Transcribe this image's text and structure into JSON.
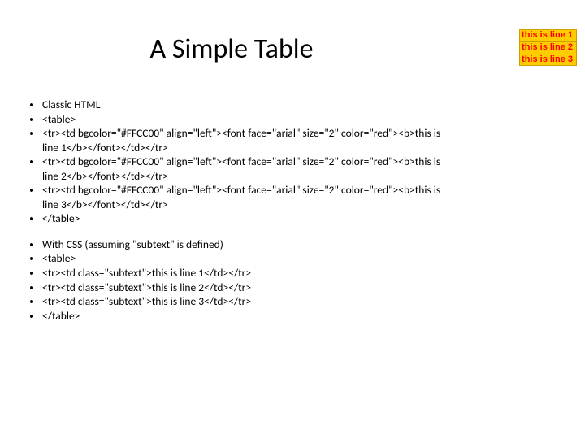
{
  "title": "A Simple Table",
  "block1": {
    "l1": "Classic HTML",
    "l2": "<table>",
    "l3": "<tr><td bgcolor=\"#FFCC00\" align=\"left\"><font face=\"arial\" size=\"2\" color=\"red\"><b>this is line 1</b></font></td></tr>",
    "l4": "<tr><td bgcolor=\"#FFCC00\" align=\"left\"><font face=\"arial\" size=\"2\" color=\"red\"><b>this is line 2</b></font></td></tr>",
    "l5": "<tr><td bgcolor=\"#FFCC00\" align=\"left\"><font face=\"arial\" size=\"2\" color=\"red\"><b>this is line 3</b></font></td></tr>",
    "l6": "</table>"
  },
  "block2": {
    "l1": "With CSS (assuming \"subtext\" is defined)",
    "l2": "<table>",
    "l3": "<tr><td class=\"subtext\">this is line 1</td></tr>",
    "l4": "<tr><td class=\"subtext\">this is line 2</td></tr>",
    "l5": "<tr><td class=\"subtext\">this is line 3</td></tr>",
    "l6": "</table>"
  },
  "demo": {
    "row1": "this is line 1",
    "row2": "this is line 2",
    "row3": "this is line 3"
  }
}
